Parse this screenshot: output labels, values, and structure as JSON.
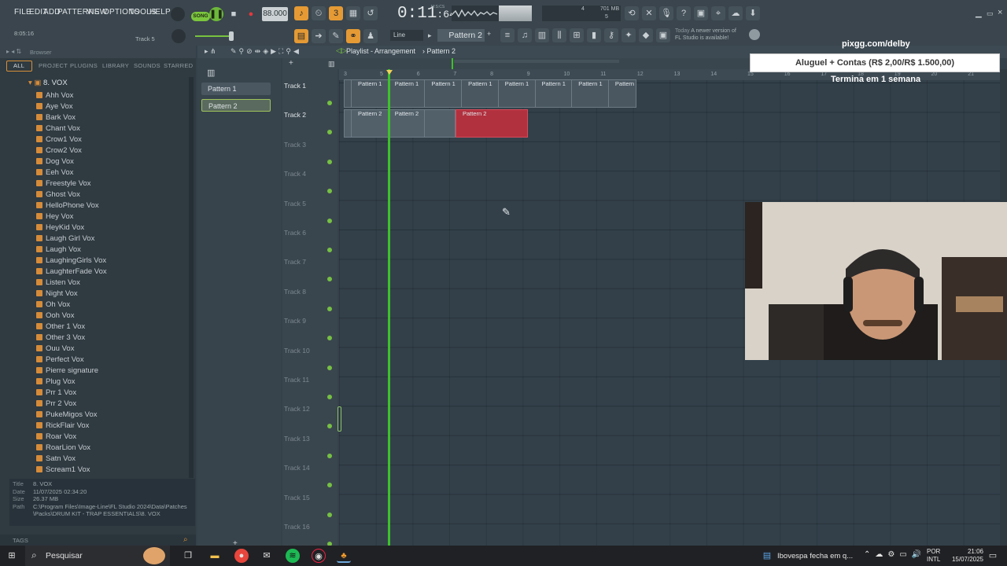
{
  "menu": [
    "FILE",
    "EDIT",
    "ADD",
    "PATTERNS",
    "VIEW",
    "OPTIONS",
    "TOOLS",
    "HELP"
  ],
  "song_label": "SONG",
  "tempo": "88.000",
  "time": {
    "main": "0:11",
    "sub": ":64",
    "unit": "M:S:CS"
  },
  "cpu": {
    "value": "4",
    "mem": "701 MB",
    "voices": "5"
  },
  "hint": {
    "elapsed": "8:05:16",
    "track": "Track 5"
  },
  "snap_mode": "Line",
  "current_pattern": "Pattern 2",
  "news": {
    "date": "Today",
    "line1": "A newer version of",
    "line2": "FL Studio is available!"
  },
  "browser": {
    "title": "Browser",
    "tabs": [
      "ALL",
      "PROJECT",
      "PLUGINS",
      "LIBRARY",
      "SOUNDS",
      "STARRED"
    ],
    "folder": "8. VOX",
    "items": [
      "Ahh Vox",
      "Aye Vox",
      "Bark Vox",
      "Chant Vox",
      "Crow1 Vox",
      "Crow2 Vox",
      "Dog Vox",
      "Eeh Vox",
      "Freestyle Vox",
      "Ghost Vox",
      "HelloPhone Vox",
      "Hey Vox",
      "HeyKid Vox",
      "Laugh Girl Vox",
      "Laugh Vox",
      "LaughingGirls Vox",
      "LaughterFade Vox",
      "Listen Vox",
      "Night Vox",
      "Oh Vox",
      "Ooh Vox",
      "Other 1 Vox",
      "Other 3 Vox",
      "Ouu Vox",
      "Perfect Vox",
      "Pierre signature",
      "Plug Vox",
      "Prr 1 Vox",
      "Prr 2 Vox",
      "PukeMigos Vox",
      "RickFlair Vox",
      "Roar Vox",
      "RoarLion Vox",
      "Satn Vox",
      "Scream1 Vox"
    ],
    "info": {
      "title_label": "Title",
      "title": "8. VOX",
      "date_label": "Date",
      "date": "11/07/2025 02:34:20",
      "size_label": "Size",
      "size": "26.37 MB",
      "path_label": "Path",
      "path": "C:\\Program Files\\Image-Line\\FL Studio 2024\\Data\\Patches\\Packs\\DRUM KIT - TRAP ESSENTIALS\\8. VOX"
    },
    "tags": "TAGS"
  },
  "patterns": [
    "Pattern 1",
    "Pattern 2"
  ],
  "playlist": {
    "title": "Playlist - Arrangement",
    "crumb": "Pattern 2",
    "tracks": [
      "Track 1",
      "Track 2",
      "Track 3",
      "Track 4",
      "Track 5",
      "Track 6",
      "Track 7",
      "Track 8",
      "Track 9",
      "Track 10",
      "Track 11",
      "Track 12",
      "Track 13",
      "Track 14",
      "Track 15",
      "Track 16"
    ],
    "ruler": [
      "3",
      "5",
      "6",
      "7",
      "8",
      "9",
      "10",
      "11",
      "12",
      "13",
      "14",
      "15",
      "16",
      "17",
      "18",
      "19",
      "20",
      "21"
    ],
    "clip_row1": "Pattern 1",
    "clip_row2": "Pattern 2"
  },
  "overlay": {
    "site": "pixgg.com/delby",
    "goal": "Aluguel + Contas (R$ 2,00/R$ 1.500,00)",
    "ends": "Termina em 1 semana"
  },
  "taskbar": {
    "search": "Pesquisar",
    "news": "Ibovespa fecha em q...",
    "lang1": "POR",
    "lang2": "INTL",
    "time": "21:06",
    "date": "15/07/2025"
  },
  "colors": {
    "accent": "#e59a34",
    "playhead": "#3ec12b",
    "clip_red": "#b1313f"
  }
}
